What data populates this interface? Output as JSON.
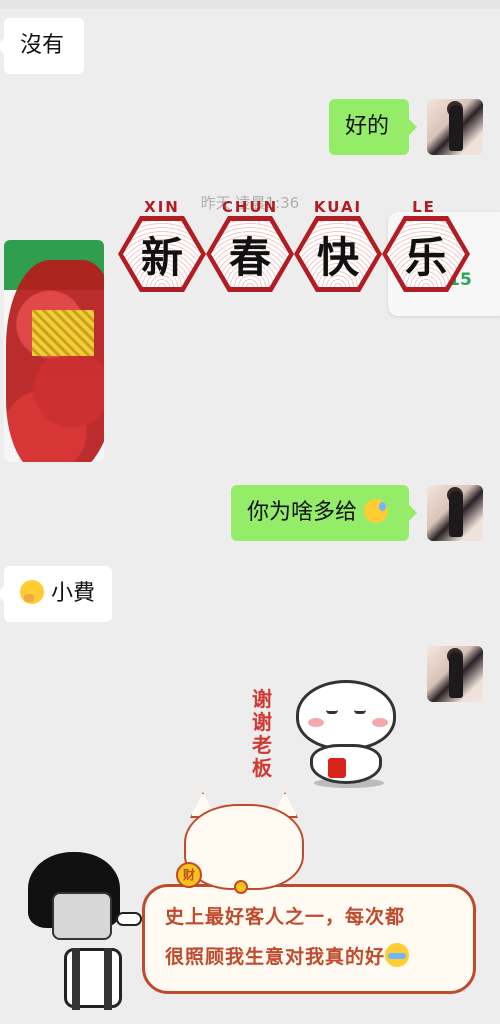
{
  "messages": {
    "m1": {
      "text": "沒有"
    },
    "m2": {
      "text": "好的"
    },
    "m3": {
      "text": "你为啥多给"
    },
    "m4": {
      "text": "小費"
    }
  },
  "timestamp": "昨天 凌晨1:36",
  "banner": {
    "chars": [
      "新",
      "春",
      "快",
      "乐"
    ],
    "pinyin": [
      "XIN",
      "CHUN",
      "KUAI",
      "LE"
    ]
  },
  "card_number": "23.15",
  "stickers": {
    "thanks": "谢谢老板",
    "cat_coin": "财",
    "scroll_line1": "史上最好客人之一，每次都",
    "scroll_line2": "很照顾我生意对我真的好"
  },
  "colors": {
    "outgoing_bubble": "#95ec69",
    "incoming_bubble": "#ffffff",
    "background": "#ededed",
    "banner_red": "#b01e23"
  },
  "icons": {
    "sweat": "sweat-smile-emoji-icon",
    "think": "thinking-emoji-icon",
    "cry": "crying-emoji-icon"
  }
}
